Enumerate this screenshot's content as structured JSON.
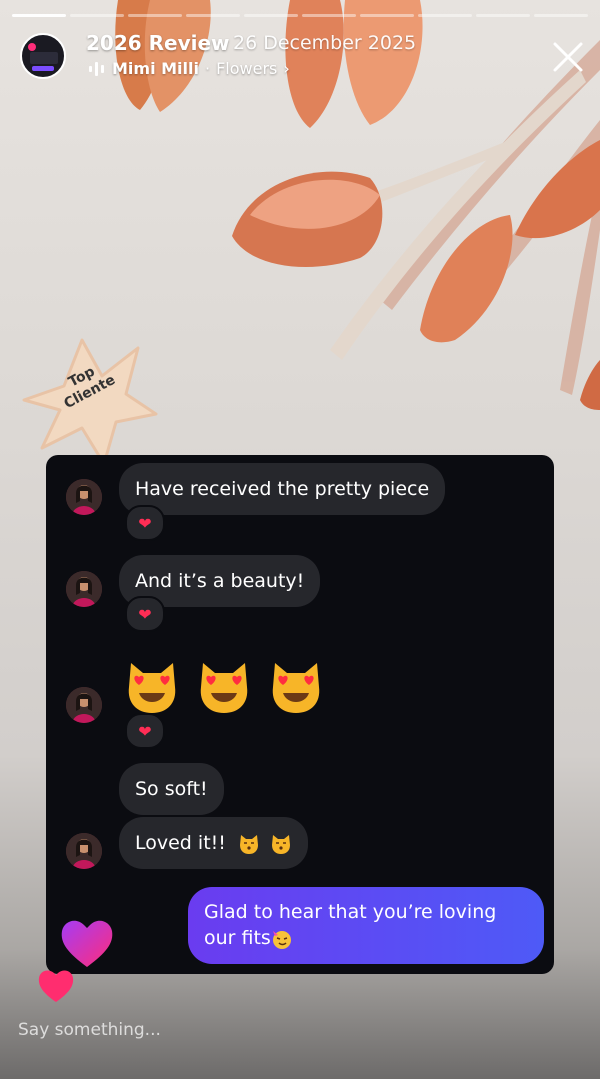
{
  "story": {
    "progress_total": 10,
    "progress_done": 1,
    "title": "2026 Review",
    "date": "26 December 2025",
    "music_artist": "Mimi Milli",
    "music_track": "Flowers",
    "music_separator": "·",
    "chevron": "›"
  },
  "sticker": {
    "line1": "Top",
    "line2": "Cliente"
  },
  "chat": {
    "messages": [
      {
        "text": "Have received the pretty piece",
        "reaction": "❤"
      },
      {
        "text": "And it’s a beauty!",
        "reaction": "❤"
      },
      {
        "emojis": [
          "smiling-cat-heart-eyes",
          "smiling-cat-heart-eyes",
          "smiling-cat-heart-eyes"
        ],
        "reaction": "❤"
      },
      {
        "text": "So soft!"
      },
      {
        "text": "Loved it!!"
      }
    ],
    "my_message": "Glad to hear that you’re loving our fits"
  },
  "reply": {
    "placeholder": "Say something..."
  },
  "colors": {
    "accent_purple": "#6a3cf0",
    "accent_blue": "#4e5af7",
    "heart_pink": "#ff2d7a",
    "bubble_gray": "#26272c",
    "chat_bg": "#0b0c11"
  }
}
